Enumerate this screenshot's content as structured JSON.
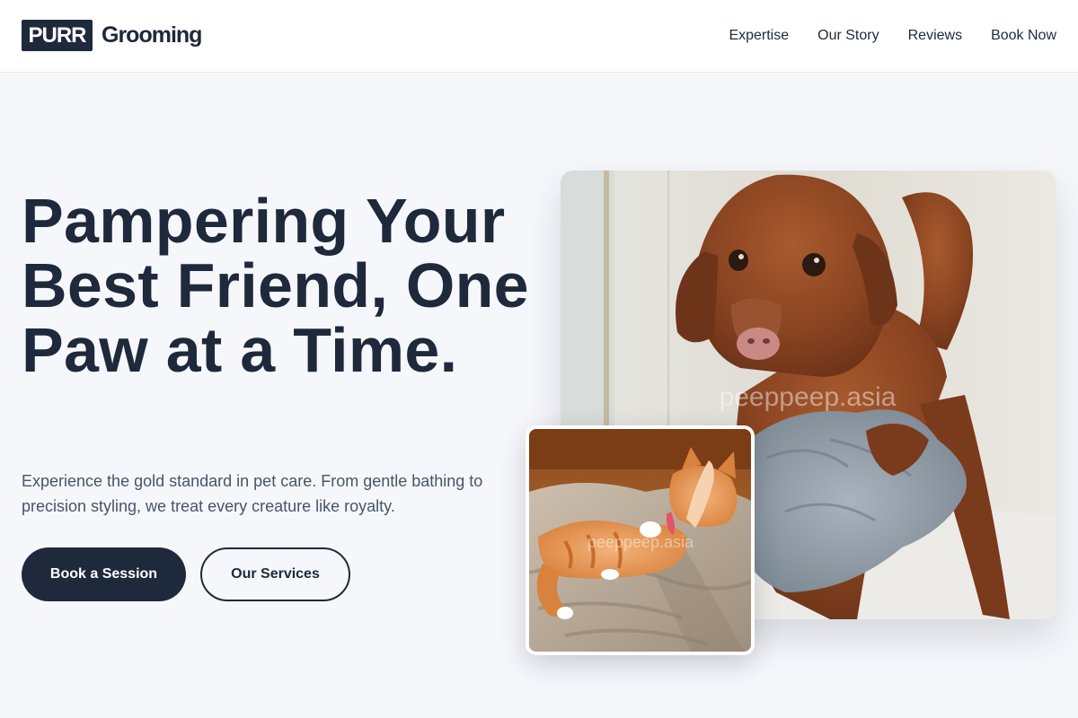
{
  "header": {
    "logo_badge": "PURR",
    "logo_text": "Grooming",
    "nav": [
      {
        "label": "Expertise"
      },
      {
        "label": "Our Story"
      },
      {
        "label": "Reviews"
      },
      {
        "label": "Book Now"
      }
    ]
  },
  "hero": {
    "headline": "Pampering Your Best Friend, One Paw at a Time.",
    "subtext": "Experience the gold standard in pet care. From gentle bathing to precision styling, we treat every creature like royalty.",
    "primary_button": "Book a Session",
    "secondary_button": "Our Services"
  },
  "images": {
    "main_watermark": "peeppeep.asia",
    "inset_watermark": "peeppeep.asia"
  },
  "colors": {
    "primary": "#1e293b",
    "background": "#f6f7fb",
    "muted_text": "#475569"
  }
}
